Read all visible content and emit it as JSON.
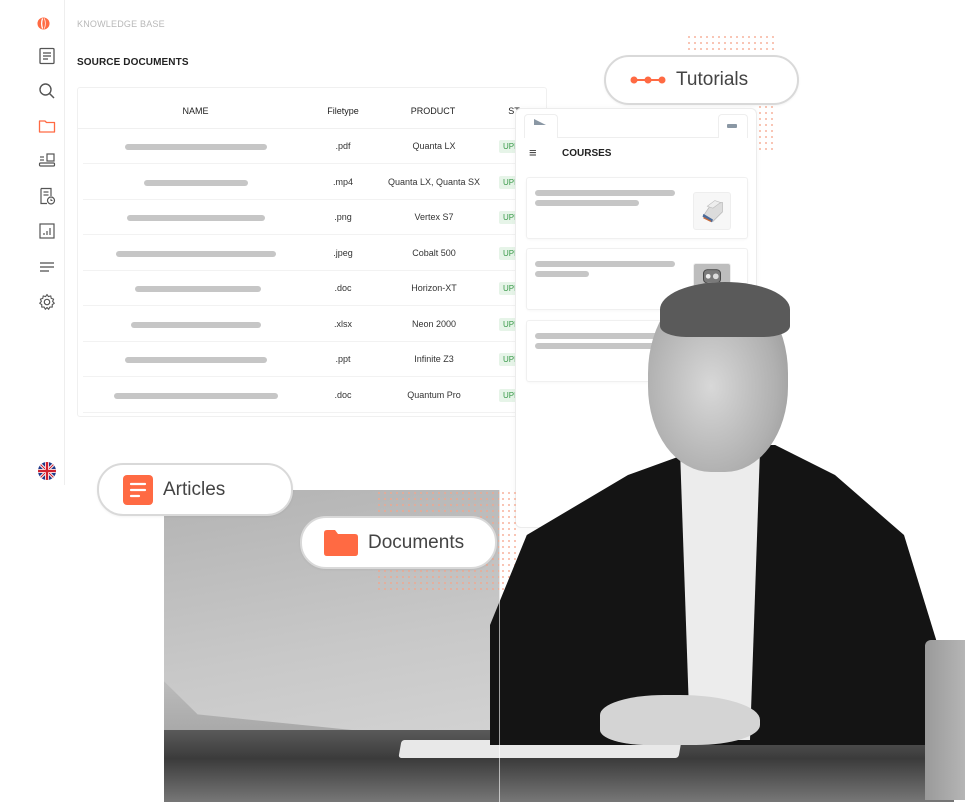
{
  "app": {
    "section_label": "KNOWLEDGE BASE",
    "page_title": "SOURCE DOCUMENTS",
    "accent_color": "#ff6a43"
  },
  "sidebar": {
    "items": [
      {
        "name": "articles",
        "icon": "document-lines-icon",
        "active": false
      },
      {
        "name": "search",
        "icon": "search-icon",
        "active": false
      },
      {
        "name": "documents",
        "icon": "folder-icon",
        "active": true
      },
      {
        "name": "devices",
        "icon": "laptop-list-icon",
        "active": false
      },
      {
        "name": "history",
        "icon": "document-clock-icon",
        "active": false
      },
      {
        "name": "reports",
        "icon": "bar-chart-icon",
        "active": false
      },
      {
        "name": "menu",
        "icon": "lines-icon",
        "active": false
      },
      {
        "name": "settings",
        "icon": "gear-icon",
        "active": false
      }
    ],
    "language": "uk-flag-icon"
  },
  "table": {
    "columns": [
      "NAME",
      "Filetype",
      "PRODUCT",
      "ST"
    ],
    "rows": [
      {
        "filetype": ".pdf",
        "product": "Quanta LX",
        "status": "UPLOADED"
      },
      {
        "filetype": ".mp4",
        "product": "Quanta LX, Quanta SX",
        "status": "UPLOADED"
      },
      {
        "filetype": ".png",
        "product": "Vertex S7",
        "status": "UPLOADED"
      },
      {
        "filetype": ".jpeg",
        "product": "Cobalt 500",
        "status": "UPLOADED"
      },
      {
        "filetype": ".doc",
        "product": "Horizon-XT",
        "status": "UPLOADED"
      },
      {
        "filetype": ".xlsx",
        "product": "Neon 2000",
        "status": "UPLOADED"
      },
      {
        "filetype": ".ppt",
        "product": "Infinite Z3",
        "status": "UPLOADED"
      },
      {
        "filetype": ".doc",
        "product": "Quantum Pro",
        "status": "UPLOADED"
      }
    ],
    "status_visible_text": "UPL"
  },
  "courses": {
    "title": "COURSES",
    "menu_icon": "hamburger-icon",
    "cards": [
      {
        "thumbnail": "connector-part-icon"
      },
      {
        "thumbnail": "metal-part-icon"
      },
      {
        "thumbnail": null
      }
    ]
  },
  "pills": {
    "tutorials": "Tutorials",
    "articles": "Articles",
    "documents": "Documents"
  }
}
